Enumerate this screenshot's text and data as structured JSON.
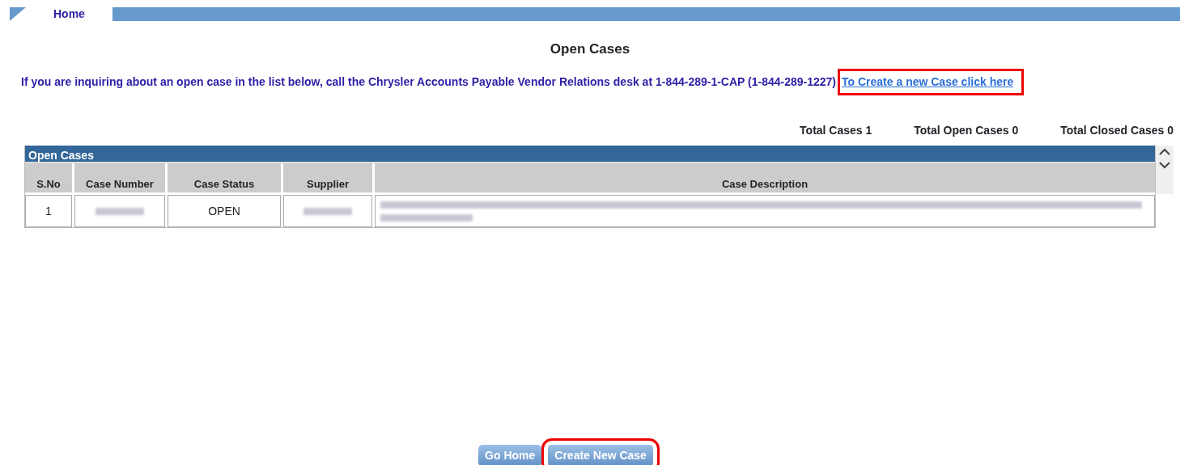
{
  "nav": {
    "items": [
      {
        "label": "Home"
      }
    ]
  },
  "title": "Open Cases",
  "notice": {
    "text": "If you are inquiring about an open case in the list below, call the Chrysler Accounts Payable Vendor Relations desk at 1-844-289-1-CAP (1-844-289-1227)",
    "link": {
      "text": "To Create a new Case click here",
      "highlighted": true
    }
  },
  "totals": [
    "Total Cases 1",
    "Total Open Cases 0",
    "Total Closed Cases 0"
  ],
  "table": {
    "title": "Open Cases",
    "columns": [
      "S.No",
      "Case Number",
      "Case Status",
      "Supplier",
      "Case Description"
    ],
    "rows": [
      {
        "cells": [
          {
            "text": "1"
          },
          {
            "redacted": true
          },
          {
            "text": "OPEN"
          },
          {
            "redacted": true
          },
          {
            "redacted": true,
            "kind": "paragraph"
          }
        ]
      }
    ]
  },
  "buttons": [
    {
      "label": "Go Home",
      "highlighted": false
    },
    {
      "label": "Create New Case",
      "highlighted": true
    }
  ]
}
